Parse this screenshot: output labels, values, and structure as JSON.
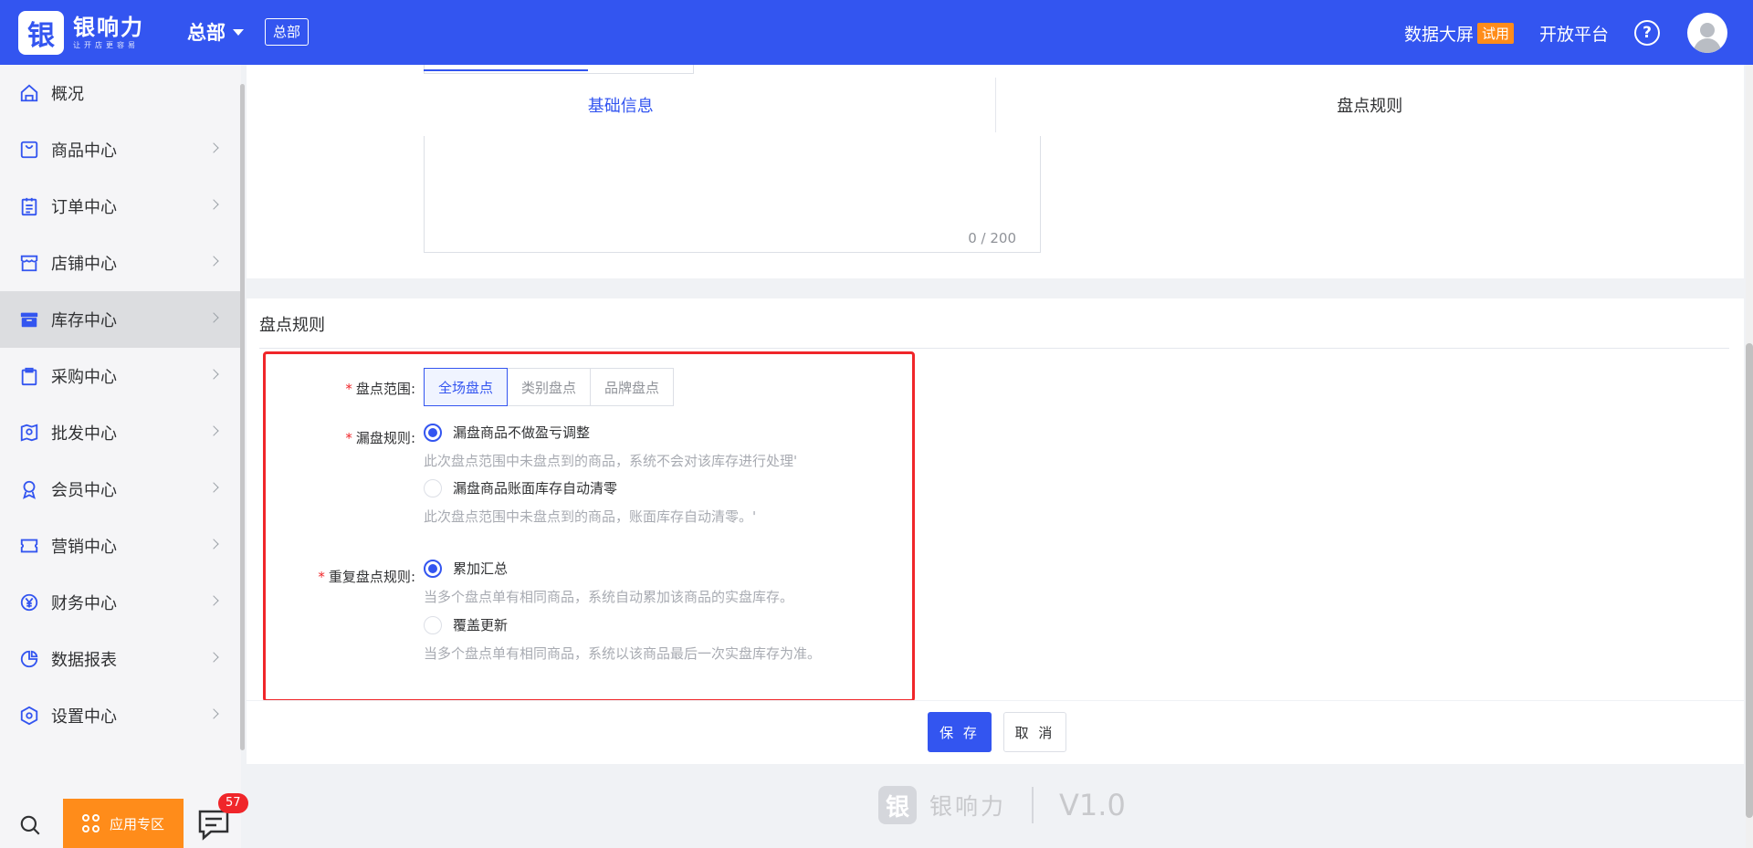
{
  "header": {
    "logo_glyph": "银",
    "logo_title": "银响力",
    "logo_sub": "让开店更容易",
    "org_name": "总部",
    "org_tag": "总部",
    "data_screen": "数据大屏",
    "trial_badge": "试用",
    "open_platform": "开放平台",
    "help_glyph": "?",
    "brand_color": "#3355f0"
  },
  "sidebar": {
    "items": [
      {
        "label": "概况",
        "icon": "home-icon"
      },
      {
        "label": "商品中心",
        "icon": "bag-icon"
      },
      {
        "label": "订单中心",
        "icon": "clipboard-icon"
      },
      {
        "label": "店铺中心",
        "icon": "store-icon"
      },
      {
        "label": "库存中心",
        "icon": "box-icon"
      },
      {
        "label": "采购中心",
        "icon": "purchase-icon"
      },
      {
        "label": "批发中心",
        "icon": "map-icon"
      },
      {
        "label": "会员中心",
        "icon": "member-icon"
      },
      {
        "label": "营销中心",
        "icon": "ticket-icon"
      },
      {
        "label": "财务中心",
        "icon": "yuan-icon"
      },
      {
        "label": "数据报表",
        "icon": "pie-icon"
      },
      {
        "label": "设置中心",
        "icon": "hexagon-icon"
      }
    ],
    "active_index": 4,
    "app_zone": "应用专区",
    "msg_count": "57"
  },
  "main": {
    "tabs": [
      "基础信息",
      "盘点规则"
    ],
    "char_count": "0 / 200",
    "section_title": "盘点规则",
    "scope": {
      "label": "盘点范围",
      "options": [
        "全场盘点",
        "类别盘点",
        "品牌盘点"
      ],
      "selected": "全场盘点"
    },
    "missing_rule": {
      "label": "漏盘规则",
      "opt1": "漏盘商品不做盈亏调整",
      "hint1": "此次盘点范围中未盘点到的商品，系统不会对该库存进行处理'",
      "opt2": "漏盘商品账面库存自动清零",
      "hint2": "此次盘点范围中未盘点到的商品，账面库存自动清零。'"
    },
    "repeat_rule": {
      "label": "重复盘点规则",
      "opt1": "累加汇总",
      "hint1": "当多个盘点单有相同商品，系统自动累加该商品的实盘库存。",
      "opt2": "覆盖更新",
      "hint2": "当多个盘点单有相同商品，系统以该商品最后一次实盘库存为准。"
    },
    "save": "保 存",
    "cancel": "取 消",
    "footer_brand": "银响力",
    "footer_glyph": "银",
    "version": "V1.0"
  }
}
